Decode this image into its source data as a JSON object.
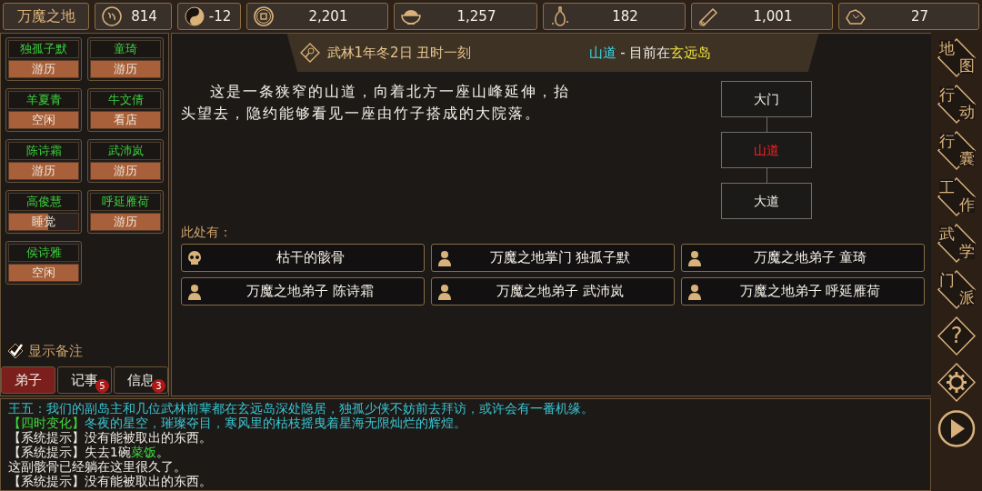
{
  "sect": {
    "name": "万魔之地"
  },
  "resources": [
    {
      "kind": "reputation",
      "value": "814"
    },
    {
      "kind": "alignment",
      "value": "-12"
    },
    {
      "kind": "money",
      "value": "2,201"
    },
    {
      "kind": "food",
      "value": "1,257"
    },
    {
      "kind": "herb",
      "value": "182"
    },
    {
      "kind": "wood",
      "value": "1,001"
    },
    {
      "kind": "ore",
      "value": "27"
    }
  ],
  "disciples": [
    {
      "name": "独孤子默",
      "status": "游历",
      "level": 1
    },
    {
      "name": "童琦",
      "status": "游历",
      "level": 1
    },
    {
      "name": "羊夏青",
      "status": "空闲",
      "level": 1
    },
    {
      "name": "牛文倩",
      "status": "看店",
      "level": 1
    },
    {
      "name": "陈诗霜",
      "status": "游历",
      "level": 1
    },
    {
      "name": "武沛岚",
      "status": "游历",
      "level": 1
    },
    {
      "name": "高俊慧",
      "status": "睡觉",
      "level": 0.57
    },
    {
      "name": "呼延雁荷",
      "status": "游历",
      "level": 1
    },
    {
      "name": "侯诗雅",
      "status": "空闲",
      "level": 1
    }
  ],
  "show_notes": {
    "label": "显示备注",
    "checked": true
  },
  "tabs": [
    {
      "label": "弟子",
      "selected": true
    },
    {
      "label": "记事",
      "selected": false,
      "badge": "5"
    },
    {
      "label": "信息",
      "selected": false,
      "badge": "3"
    }
  ],
  "header": {
    "date": "武林1年冬2日 丑时一刻",
    "place": "山道",
    "separator": "-",
    "prefix": "目前在",
    "region": "玄远岛"
  },
  "description": "这是一条狭窄的山道，向着北方一座山峰延伸，抬头望去，隐约能够看见一座由竹子搭成的大院落。",
  "map": [
    {
      "label": "大门",
      "selected": false
    },
    {
      "label": "山道",
      "selected": true
    },
    {
      "label": "大道",
      "selected": false
    }
  ],
  "here": {
    "label": "此处有：",
    "entities": [
      {
        "kind": "remains",
        "text": "枯干的骸骨"
      },
      {
        "kind": "person",
        "text": "万魔之地掌门 独孤子默"
      },
      {
        "kind": "person",
        "text": "万魔之地弟子 童琦"
      },
      {
        "kind": "person",
        "text": "万魔之地弟子 陈诗霜"
      },
      {
        "kind": "person",
        "text": "万魔之地弟子 武沛岚"
      },
      {
        "kind": "person",
        "text": "万魔之地弟子 呼延雁荷"
      }
    ]
  },
  "side_menu": [
    {
      "kind": "text",
      "label": "地图"
    },
    {
      "kind": "text",
      "label": "行动"
    },
    {
      "kind": "text",
      "label": "行囊"
    },
    {
      "kind": "text",
      "label": "工作"
    },
    {
      "kind": "text",
      "label": "武学"
    },
    {
      "kind": "text",
      "label": "门派"
    },
    {
      "kind": "text",
      "label": "?"
    },
    {
      "kind": "settings"
    },
    {
      "kind": "play"
    }
  ],
  "log": [
    {
      "segments": [
        {
          "text": "王五：我们的副岛主和几位武林前辈都在玄远岛深处隐居，独孤少侠不妨前去拜访，或许会有一番机缘。",
          "color": "#38c4d0"
        }
      ]
    },
    {
      "segments": [
        {
          "text": "【四时变化】",
          "color": "#3ddc3d"
        },
        {
          "text": "冬夜的星空，璀璨夺目，寒风里的枯枝摇曳着星海无限灿烂的辉煌。",
          "color": "#38c4d0"
        }
      ]
    },
    {
      "segments": [
        {
          "text": "【系统提示】没有能被取出的东西。",
          "color": "#f0ece4"
        }
      ]
    },
    {
      "segments": [
        {
          "text": "【系统提示】失去1碗",
          "color": "#f0ece4"
        },
        {
          "text": "菜饭",
          "color": "#3ddc3d"
        },
        {
          "text": "。",
          "color": "#f0ece4"
        }
      ]
    },
    {
      "segments": [
        {
          "text": "这副骸骨已经躺在这里很久了。",
          "color": "#f0ece4"
        }
      ]
    },
    {
      "segments": [
        {
          "text": "【系统提示】没有能被取出的东西。",
          "color": "#f0ece4"
        }
      ]
    }
  ]
}
